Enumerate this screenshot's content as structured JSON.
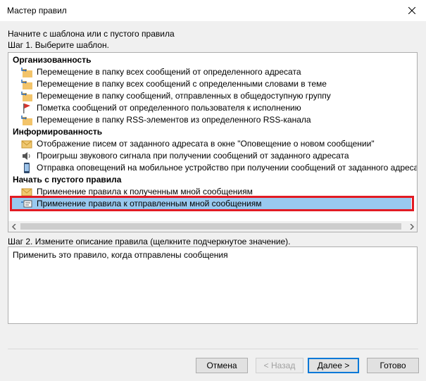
{
  "window": {
    "title": "Мастер правил"
  },
  "intro": {
    "heading": "Начните с шаблона или с пустого правила",
    "step1": "Шаг 1. Выберите шаблон."
  },
  "templates": {
    "group_organize": "Организованность",
    "move_from_sender": "Перемещение в папку всех сообщений от определенного адресата",
    "move_with_words": "Перемещение в папку всех сообщений с определенными словами в теме",
    "move_public_group": "Перемещение в папку сообщений, отправленных в общедоступную группу",
    "flag_from_user": "Пометка сообщений от определенного пользователя к исполнению",
    "move_rss": "Перемещение в папку RSS-элементов из определенного RSS-канала",
    "group_inform": "Информированность",
    "alert_window": "Отображение писем от заданного адресата в окне \"Оповещение о новом сообщении\"",
    "play_sound": "Проигрыш звукового сигнала при получении сообщений от заданного адресата",
    "mobile_alert": "Отправка оповещений на мобильное устройство при получении сообщений от заданного адреса",
    "group_blank": "Начать с пустого правила",
    "apply_received": "Применение правила к полученным мной сообщениям",
    "apply_sent": "Применение правила к отправленным мной сообщениям"
  },
  "step2": {
    "label": "Шаг 2. Измените описание правила (щелкните подчеркнутое значение).",
    "description": "Применить это правило, когда отправлены сообщения"
  },
  "buttons": {
    "cancel": "Отмена",
    "back": "< Назад",
    "next": "Далее >",
    "finish": "Готово"
  }
}
